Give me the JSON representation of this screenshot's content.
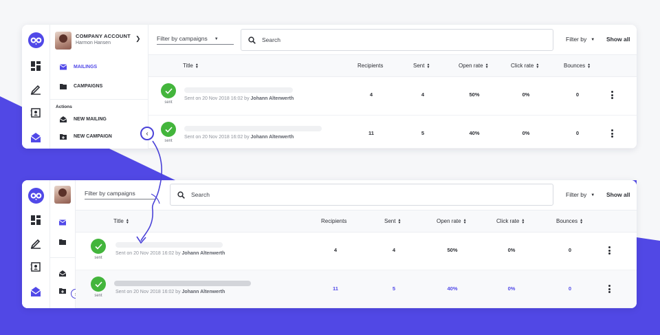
{
  "colors": {
    "accent": "#5149e8",
    "success": "#43b53c",
    "background_shape": "#5148e5"
  },
  "account": {
    "name": "COMPANY ACCOUNT",
    "user": "Harmon Hansen"
  },
  "sidebar": {
    "items": [
      {
        "label": "MAILINGS",
        "icon": "envelope-icon",
        "active": true
      },
      {
        "label": "CAMPAIGNS",
        "icon": "folder-icon",
        "active": false
      }
    ],
    "actions_label": "Actions",
    "actions": [
      {
        "label": "NEW MAILING",
        "icon": "open-envelope-icon"
      },
      {
        "label": "NEW CAMPAIGN",
        "icon": "folder-plus-icon"
      }
    ]
  },
  "rail_icons": [
    "dashboard-icon",
    "pen-icon",
    "contacts-icon",
    "mail-icon"
  ],
  "toolbar": {
    "filter_campaigns": "Filter by campaigns",
    "search_placeholder": "Search",
    "filter_by": "Filter by",
    "show_all": "Show all"
  },
  "table": {
    "columns": {
      "title": "Title",
      "recipients": "Recipients",
      "sent": "Sent",
      "open_rate": "Open rate",
      "click_rate": "Click rate",
      "bounces": "Bounces"
    },
    "rows": [
      {
        "status": "sent",
        "sent_prefix": "Sent on 20 Nov 2018 16:02 by",
        "author": "Johann Altenwerth",
        "recipients": "4",
        "sent": "4",
        "open_rate": "50%",
        "click_rate": "0%",
        "bounces": "0"
      },
      {
        "status": "sent",
        "sent_prefix": "Sent on 20 Nov 2018 16:02 by",
        "author": "Johann Altenwerth",
        "recipients": "11",
        "sent": "5",
        "open_rate": "40%",
        "click_rate": "0%",
        "bounces": "0"
      }
    ]
  }
}
